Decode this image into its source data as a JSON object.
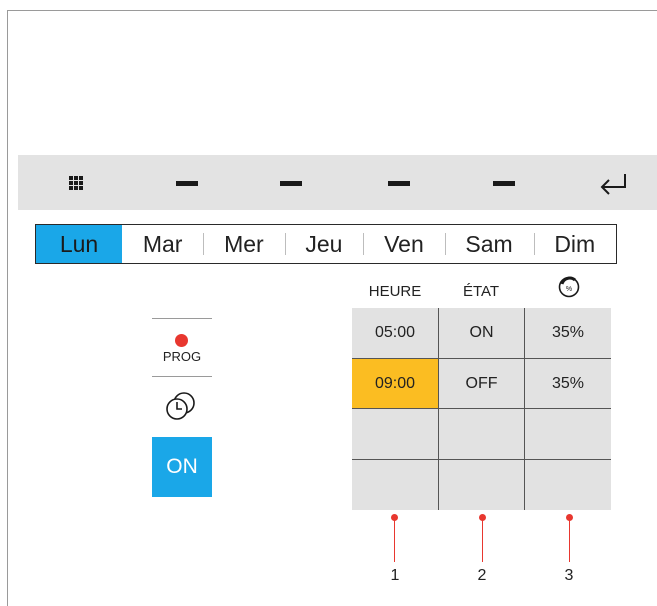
{
  "toolbar": {
    "icons": [
      "grid-menu-icon",
      "dash-icon",
      "dash-icon",
      "dash-icon",
      "dash-icon",
      "return-arrow-icon"
    ]
  },
  "days": [
    "Lun",
    "Mar",
    "Mer",
    "Jeu",
    "Ven",
    "Sam",
    "Dim"
  ],
  "selected_day": "Lun",
  "left_panel": {
    "prog_label": "PROG",
    "on_label": "ON"
  },
  "table": {
    "headers": [
      "HEURE",
      "ÉTAT"
    ],
    "percent_header_icon": "percent-dial-icon",
    "rows": [
      [
        "05:00",
        "ON",
        "35%"
      ],
      [
        "09:00",
        "OFF",
        "35%"
      ],
      [
        "",
        "",
        ""
      ],
      [
        "",
        "",
        ""
      ]
    ],
    "highlighted_cell": "09:00"
  },
  "callouts": [
    "1",
    "2",
    "3"
  ],
  "colors": {
    "accent_blue": "#1aa7e8",
    "highlight_yellow": "#fbbd22",
    "callout_red": "#e8372f",
    "toolbar_gray": "#e3e3e3"
  }
}
